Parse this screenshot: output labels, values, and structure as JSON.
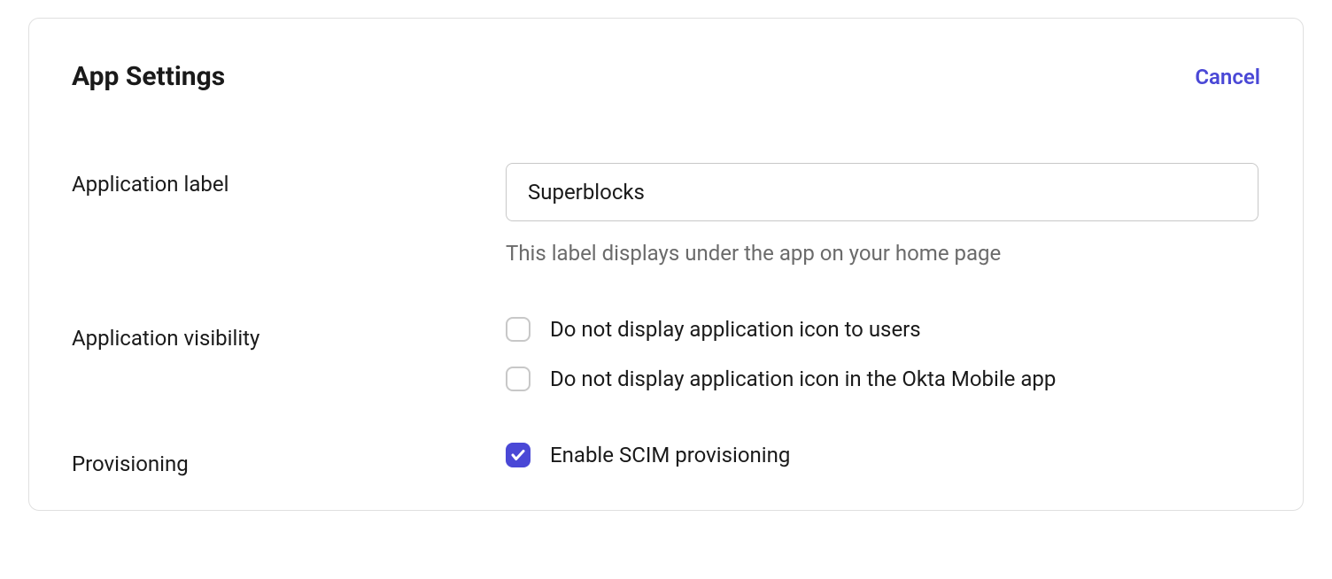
{
  "header": {
    "title": "App Settings",
    "cancel": "Cancel"
  },
  "fields": {
    "appLabel": {
      "label": "Application label",
      "value": "Superblocks",
      "helper": "This label displays under the app on your home page"
    },
    "visibility": {
      "label": "Application visibility",
      "options": [
        {
          "label": "Do not display application icon to users",
          "checked": false
        },
        {
          "label": "Do not display application icon in the Okta Mobile app",
          "checked": false
        }
      ]
    },
    "provisioning": {
      "label": "Provisioning",
      "options": [
        {
          "label": "Enable SCIM provisioning",
          "checked": true
        }
      ]
    }
  }
}
